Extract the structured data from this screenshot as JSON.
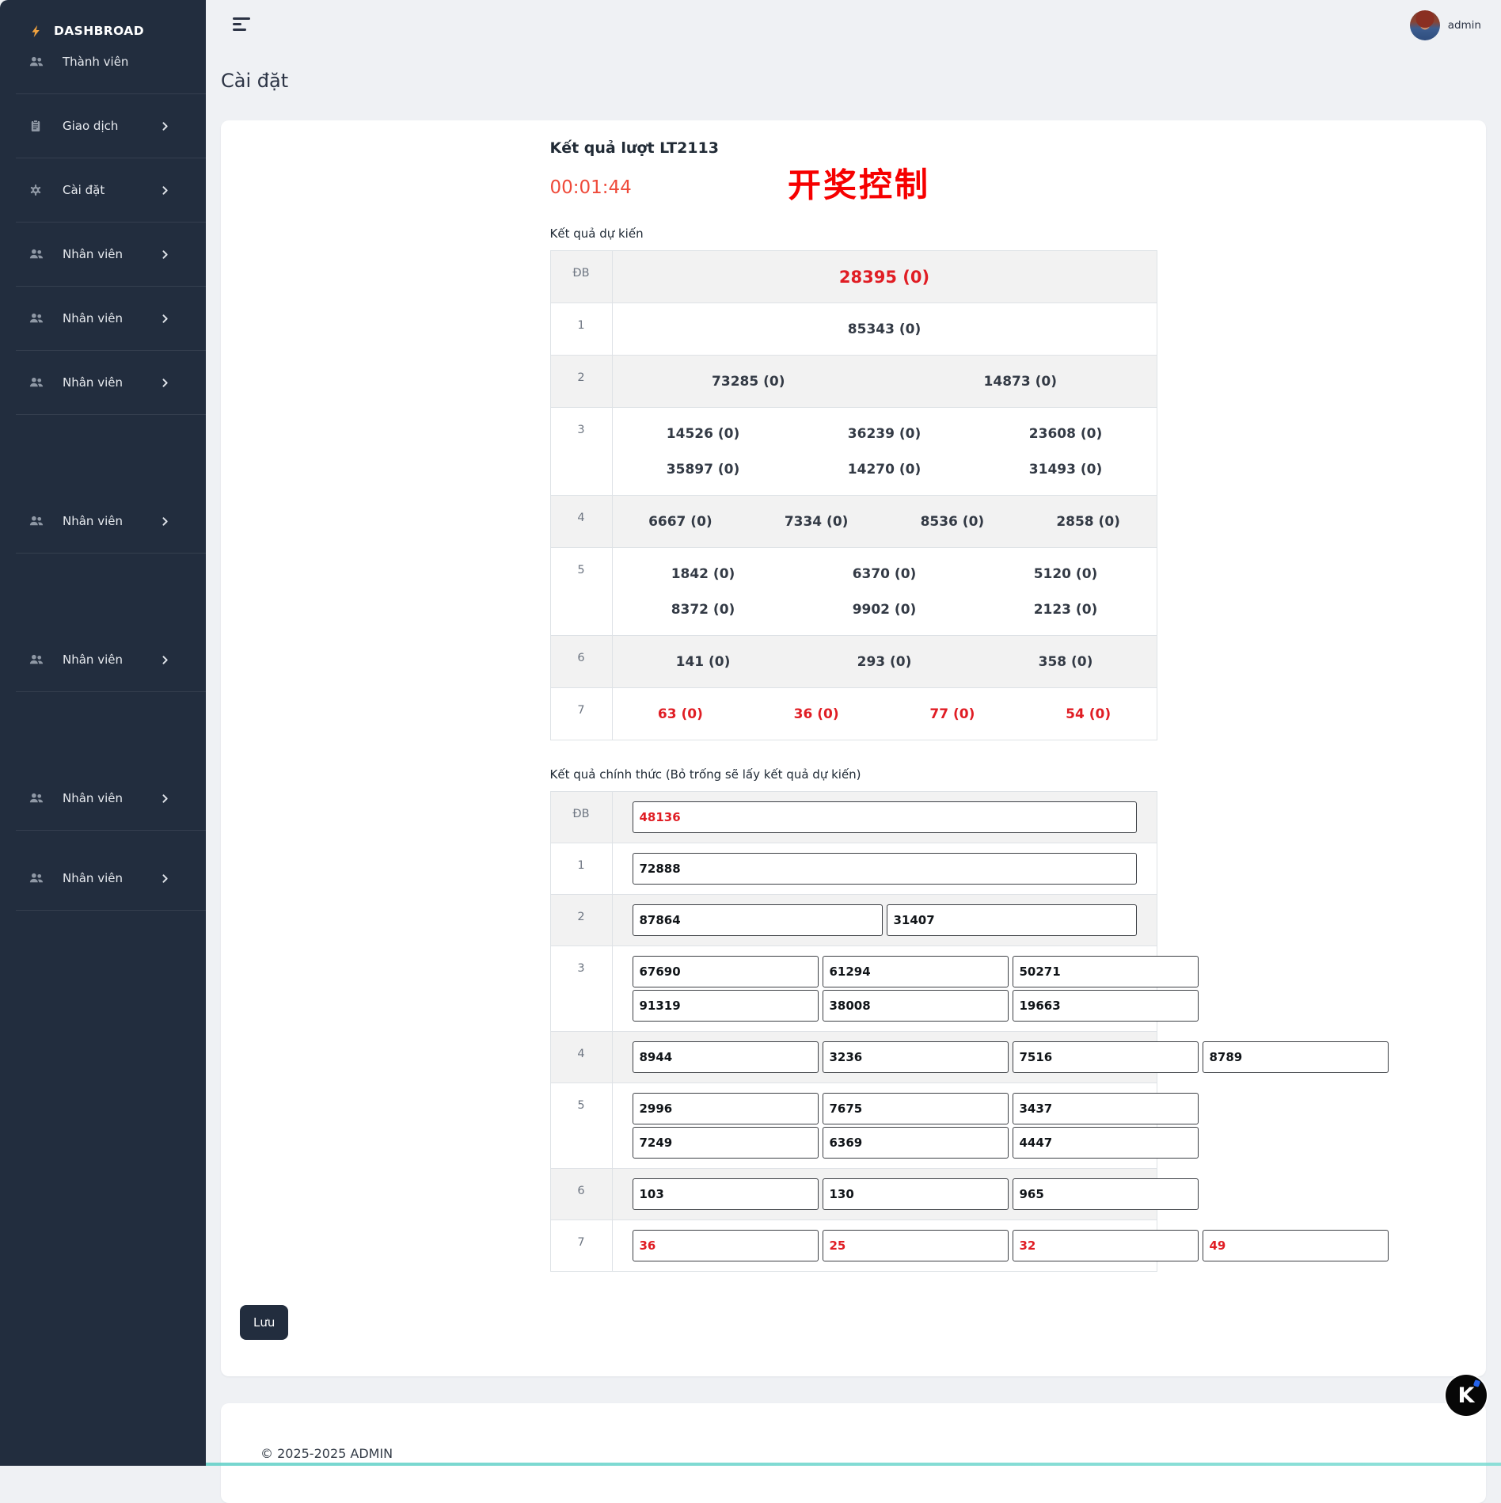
{
  "sidebar": {
    "brand": "DASHBROAD",
    "items": [
      {
        "label": "Thành viên",
        "icon": "users",
        "chevron": false
      },
      {
        "label": "Giao dịch",
        "icon": "clipboard",
        "chevron": true
      },
      {
        "label": "Cài đặt",
        "icon": "gear",
        "chevron": true
      },
      {
        "label": "Nhân viên",
        "icon": "users",
        "chevron": true
      },
      {
        "label": "Nhân viên",
        "icon": "users",
        "chevron": true
      },
      {
        "label": "Nhân viên",
        "icon": "users",
        "chevron": true
      },
      {
        "label": "Nhân viên",
        "icon": "users",
        "chevron": true
      },
      {
        "label": "Nhân viên",
        "icon": "users",
        "chevron": true
      },
      {
        "label": "Nhân viên",
        "icon": "users",
        "chevron": true
      },
      {
        "label": "Nhân viên",
        "icon": "users",
        "chevron": true
      }
    ]
  },
  "header": {
    "user": "admin"
  },
  "page": {
    "title": "Cài đặt"
  },
  "panel": {
    "round_title": "Kết quả lượt LT2113",
    "countdown": "00:01:44",
    "watermark": "开奖控制",
    "expected_label": "Kết quả dự kiến",
    "official_label": "Kết quả chính thức (Bỏ trống sẽ lấy kết quả dự kiến)",
    "save_label": "Lưu"
  },
  "expected_table": {
    "rows": [
      {
        "label": "ĐB",
        "red": true,
        "big": true,
        "lines": [
          [
            "28395 (0)"
          ]
        ]
      },
      {
        "label": "1",
        "lines": [
          [
            "85343 (0)"
          ]
        ]
      },
      {
        "label": "2",
        "lines": [
          [
            "73285 (0)",
            "14873 (0)"
          ]
        ]
      },
      {
        "label": "3",
        "lines": [
          [
            "14526 (0)",
            "36239 (0)",
            "23608 (0)"
          ],
          [
            "35897 (0)",
            "14270 (0)",
            "31493 (0)"
          ]
        ]
      },
      {
        "label": "4",
        "lines": [
          [
            "6667 (0)",
            "7334 (0)",
            "8536 (0)",
            "2858 (0)"
          ]
        ]
      },
      {
        "label": "5",
        "lines": [
          [
            "1842 (0)",
            "6370 (0)",
            "5120 (0)"
          ],
          [
            "8372 (0)",
            "9902 (0)",
            "2123 (0)"
          ]
        ]
      },
      {
        "label": "6",
        "lines": [
          [
            "141 (0)",
            "293 (0)",
            "358 (0)"
          ]
        ]
      },
      {
        "label": "7",
        "red": true,
        "lines": [
          [
            "63 (0)",
            "36 (0)",
            "77 (0)",
            "54 (0)"
          ]
        ]
      }
    ]
  },
  "official_table": {
    "rows": [
      {
        "label": "ĐB",
        "red": true,
        "lines": [
          [
            "48136"
          ]
        ]
      },
      {
        "label": "1",
        "lines": [
          [
            "72888"
          ]
        ]
      },
      {
        "label": "2",
        "lines": [
          [
            "87864",
            "31407"
          ]
        ]
      },
      {
        "label": "3",
        "lines": [
          [
            "67690",
            "61294",
            "50271"
          ],
          [
            "91319",
            "38008",
            "19663"
          ]
        ]
      },
      {
        "label": "4",
        "lines": [
          [
            "8944",
            "3236",
            "7516",
            "8789"
          ]
        ]
      },
      {
        "label": "5",
        "lines": [
          [
            "2996",
            "7675",
            "3437"
          ],
          [
            "7249",
            "6369",
            "4447"
          ]
        ]
      },
      {
        "label": "6",
        "lines": [
          [
            "103",
            "130",
            "965"
          ]
        ]
      },
      {
        "label": "7",
        "red": true,
        "lines": [
          [
            "36",
            "25",
            "32",
            "49"
          ]
        ]
      }
    ]
  },
  "footer": {
    "copyright": "© 2025-2025 ADMIN",
    "badge": "K"
  }
}
